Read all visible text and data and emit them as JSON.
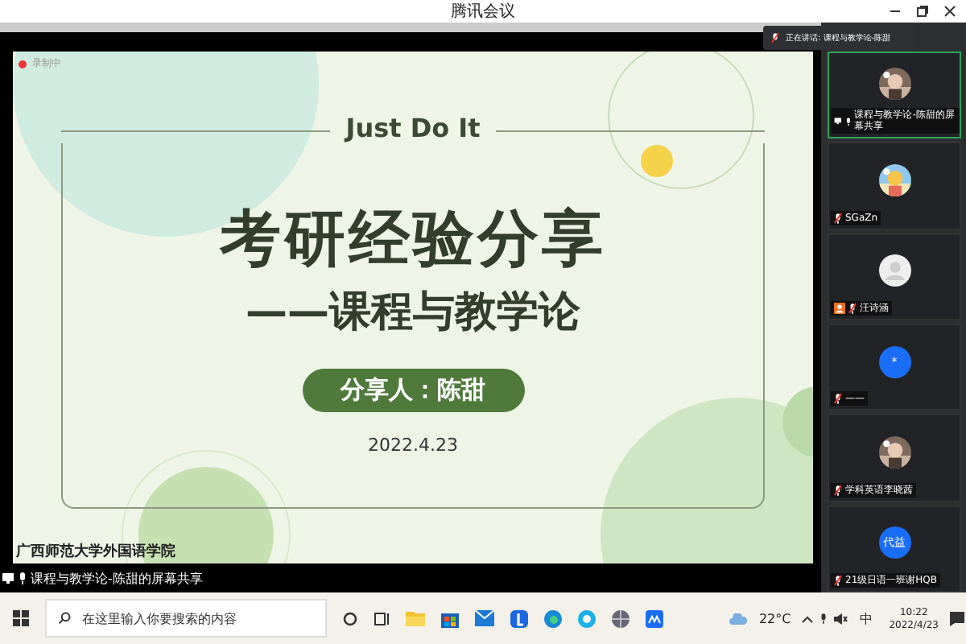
{
  "window": {
    "title": "腾讯会议"
  },
  "recording": {
    "label": "录制中"
  },
  "speaking_toast": {
    "text": "正在讲话: 课程与教学论-陈甜"
  },
  "slide": {
    "tagline": "Just Do It",
    "title": "考研经验分享",
    "subtitle": "——课程与教学论",
    "presenter": "分享人：陈甜",
    "date": "2022.4.23",
    "footer": "广西师范大学外国语学院"
  },
  "share_label": "课程与教学论-陈甜的屏幕共享",
  "participants": [
    {
      "name": "课程与教学论-陈甜的屏幕共享",
      "muted": false,
      "sharing": true,
      "host": false,
      "selected": true
    },
    {
      "name": "SGaZn",
      "muted": true,
      "sharing": false,
      "host": false,
      "selected": false
    },
    {
      "name": "汪诗涵",
      "kind": "default",
      "muted": true,
      "sharing": false,
      "host": true,
      "selected": false
    },
    {
      "name": "——",
      "kind": "text",
      "avatar_text": "*",
      "muted": true,
      "sharing": false,
      "host": false,
      "selected": false
    },
    {
      "name": "学科英语李晓茜",
      "muted": true,
      "sharing": false,
      "host": false,
      "selected": false
    },
    {
      "name": "21级日语一班谢HQB",
      "kind": "text",
      "avatar_text": "代益",
      "muted": true,
      "sharing": false,
      "host": false,
      "selected": false
    }
  ],
  "taskbar": {
    "search_placeholder": "在这里输入你要搜索的内容",
    "temperature": "22°C",
    "ime": "中",
    "time": "10:22",
    "date": "2022/4/23"
  }
}
